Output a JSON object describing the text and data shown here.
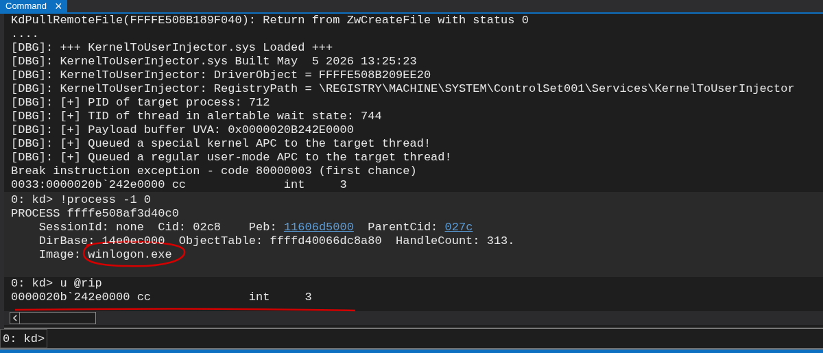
{
  "tab": {
    "title": "Command",
    "close": "×",
    "selected": true
  },
  "blocks": [
    {
      "kind": "output",
      "lines": [
        "KdPullRemoteFile(FFFFE508B189F040): Return from ZwCreateFile with status 0",
        "....",
        "[DBG]: +++ KernelToUserInjector.sys Loaded +++",
        "[DBG]: KernelToUserInjector.sys Built May  5 2026 13:25:23",
        "[DBG]: KernelToUserInjector: DriverObject = FFFFE508B209EE20",
        "[DBG]: KernelToUserInjector: RegistryPath = \\REGISTRY\\MACHINE\\SYSTEM\\ControlSet001\\Services\\KernelToUserInjector",
        "[DBG]: [+] PID of target process: 712",
        "[DBG]: [+] TID of thread in alertable wait state: 744",
        "[DBG]: [+] Payload buffer UVA: 0x0000020B242E0000",
        "[DBG]: [+] Queued a special kernel APC to the target thread!",
        "[DBG]: [+] Queued a regular user-mode APC to the target thread!",
        "Break instruction exception - code 80000003 (first chance)",
        "0033:0000020b`242e0000 cc              int     3"
      ]
    },
    {
      "kind": "command",
      "lines": [
        "0: kd> !process -1 0",
        "PROCESS ffffe508af3d40c0",
        [
          {
            "text": "    SessionId: none  Cid: 02c8    Peb: ",
            "link": false
          },
          {
            "text": "11606d5000",
            "link": true
          },
          {
            "text": "  ParentCid: ",
            "link": false
          },
          {
            "text": "027c",
            "link": true
          }
        ],
        "    DirBase: 14e0ec000  ObjectTable: ffffd40066dc8a80  HandleCount: 313.",
        "    Image: winlogon.exe"
      ]
    },
    {
      "kind": "output",
      "lines": [
        "0: kd> u @rip",
        "0000020b`242e0000 cc              int     3"
      ]
    }
  ],
  "input": {
    "prompt": "0: kd>"
  }
}
